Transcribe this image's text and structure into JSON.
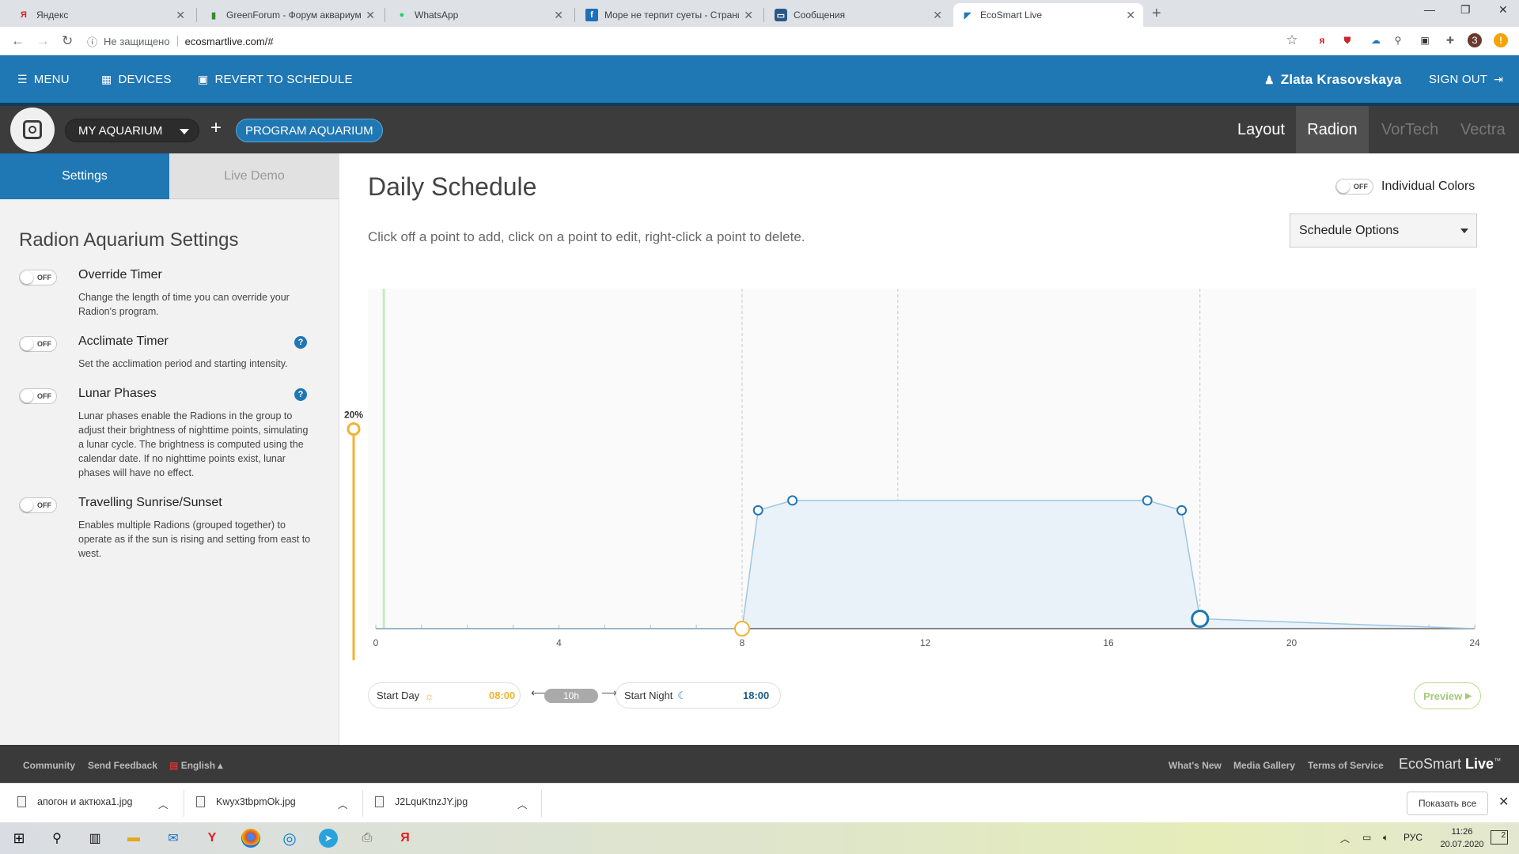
{
  "browser": {
    "tabs": [
      {
        "title": "Яндекс",
        "favicon": "yandex-icon",
        "active": false
      },
      {
        "title": "GreenForum - Форум аквариумистов",
        "favicon": "greenforum-icon",
        "active": false
      },
      {
        "title": "WhatsApp",
        "favicon": "whatsapp-icon",
        "active": false
      },
      {
        "title": "Море не терпит суеты - Страница",
        "favicon": "page-icon",
        "active": false
      },
      {
        "title": "Сообщения",
        "favicon": "messages-icon",
        "active": false
      },
      {
        "title": "EcoSmart Live",
        "favicon": "ecosmart-icon",
        "active": true
      }
    ],
    "security_label": "Не защищено",
    "url": "ecosmartlive.com/#",
    "profile_initial": "З"
  },
  "header": {
    "menu": "MENU",
    "devices": "DEVICES",
    "revert": "REVERT TO SCHEDULE",
    "user": "Zlata Krasovskaya",
    "signout": "SIGN OUT"
  },
  "subheader": {
    "aquarium": "MY AQUARIUM",
    "program": "PROGRAM AQUARIUM",
    "device_tabs": [
      "Layout",
      "Radion",
      "VorTech",
      "Vectra"
    ],
    "active_tab": "Radion"
  },
  "left_panel": {
    "tab_settings": "Settings",
    "tab_demo": "Live Demo",
    "title": "Radion Aquarium Settings",
    "toggle_off": "OFF",
    "settings": [
      {
        "name": "Override Timer",
        "desc": "Change the length of time you can override your Radion's program.",
        "help": false
      },
      {
        "name": "Acclimate Timer",
        "desc": "Set the acclimation period and starting intensity.",
        "help": true
      },
      {
        "name": "Lunar Phases",
        "desc": "Lunar phases enable the Radions in the group to adjust their brightness of nighttime points, simulating a lunar cycle. The brightness is computed using the calendar date. If no nighttime points exist, lunar phases will have no effect.",
        "help": true
      },
      {
        "name": "Travelling Sunrise/Sunset",
        "desc": "Enables multiple Radions (grouped together) to operate as if the sun is rising and setting from east to west.",
        "help": false
      }
    ]
  },
  "main": {
    "title": "Daily Schedule",
    "description": "Click off a point to add, click on a point to edit, right-click a point to delete.",
    "individual_colors": "Individual Colors",
    "schedule_options": "Schedule Options",
    "start_day_label": "Start Day",
    "start_day_time": "08:00",
    "duration": "10h",
    "start_night_label": "Start Night",
    "start_night_time": "18:00",
    "preview": "Preview"
  },
  "chart_data": {
    "type": "line",
    "x_ticks": [
      0,
      4,
      8,
      12,
      16,
      20,
      24
    ],
    "xlim": [
      0,
      24
    ],
    "ylim": [
      0,
      100
    ],
    "intensity_marker_label": "20%",
    "intensity_marker_value": 20,
    "points": [
      {
        "x": 0,
        "y": 0
      },
      {
        "x": 8,
        "y": 0
      },
      {
        "x": 8.35,
        "y": 12
      },
      {
        "x": 9.1,
        "y": 13
      },
      {
        "x": 16.85,
        "y": 13
      },
      {
        "x": 17.6,
        "y": 12
      },
      {
        "x": 18,
        "y": 1
      },
      {
        "x": 24,
        "y": 0
      }
    ],
    "highlight_points": {
      "start_day": 8,
      "start_night": 18
    },
    "colors": {
      "line": "#9ec6df",
      "fill": "#e9f2f9",
      "point": "#1f77b4",
      "sun": "#f0b331"
    }
  },
  "footer": {
    "community": "Community",
    "feedback": "Send Feedback",
    "language": "English",
    "whats_new": "What's New",
    "media": "Media Gallery",
    "tos": "Terms of Service",
    "brand_a": "EcoSmart",
    "brand_b": "Live",
    "brand_tm": "™"
  },
  "downloads": {
    "files": [
      "апогон и актюха1.jpg",
      "Kwyx3tbpmOk.jpg",
      "J2LquKtnzJY.jpg"
    ],
    "show_all": "Показать все"
  },
  "taskbar": {
    "lang": "РУС",
    "time": "11:26",
    "date": "20.07.2020",
    "notifications": "2"
  },
  "colors": {
    "brand_blue": "#1f77b4",
    "dark_bar": "#3c3c3c",
    "footer": "#3a3a3a"
  }
}
